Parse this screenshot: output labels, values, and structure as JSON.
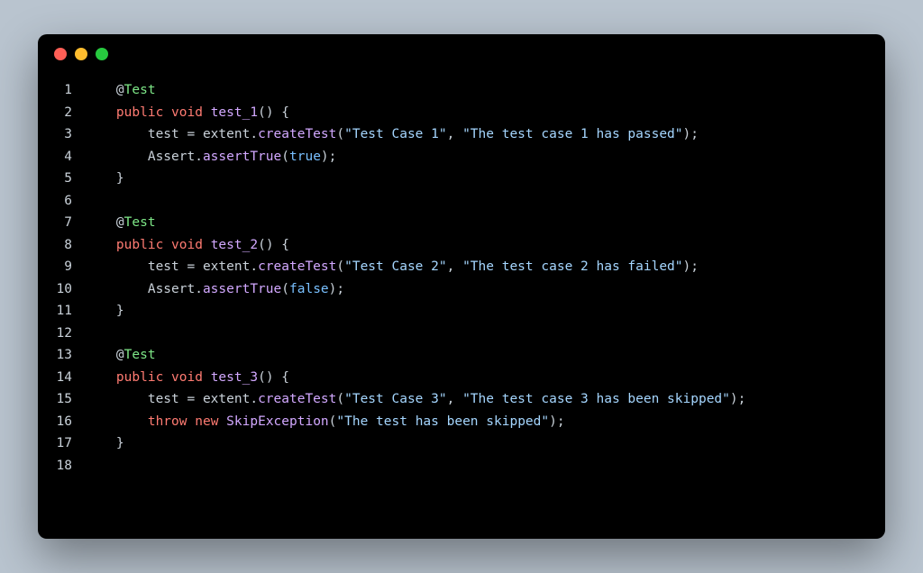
{
  "titlebar": {
    "buttons": [
      "close",
      "minimize",
      "zoom"
    ]
  },
  "code": {
    "lines": [
      {
        "num": "1",
        "tokens": [
          {
            "t": "    ",
            "c": "tok-ident"
          },
          {
            "t": "@",
            "c": "tok-at"
          },
          {
            "t": "Test",
            "c": "tok-annotation"
          }
        ]
      },
      {
        "num": "2",
        "tokens": [
          {
            "t": "    ",
            "c": "tok-ident"
          },
          {
            "t": "public",
            "c": "tok-keyword"
          },
          {
            "t": " ",
            "c": "tok-ident"
          },
          {
            "t": "void",
            "c": "tok-type"
          },
          {
            "t": " ",
            "c": "tok-ident"
          },
          {
            "t": "test_1",
            "c": "tok-method"
          },
          {
            "t": "() {",
            "c": "tok-punc"
          }
        ]
      },
      {
        "num": "3",
        "tokens": [
          {
            "t": "        test = extent.",
            "c": "tok-ident"
          },
          {
            "t": "createTest",
            "c": "tok-method"
          },
          {
            "t": "(",
            "c": "tok-punc"
          },
          {
            "t": "\"Test Case 1\"",
            "c": "tok-string"
          },
          {
            "t": ", ",
            "c": "tok-punc"
          },
          {
            "t": "\"The test case 1 has passed\"",
            "c": "tok-string"
          },
          {
            "t": ");",
            "c": "tok-punc"
          }
        ]
      },
      {
        "num": "4",
        "tokens": [
          {
            "t": "        Assert.",
            "c": "tok-ident"
          },
          {
            "t": "assertTrue",
            "c": "tok-method"
          },
          {
            "t": "(",
            "c": "tok-punc"
          },
          {
            "t": "true",
            "c": "tok-bool"
          },
          {
            "t": ");",
            "c": "tok-punc"
          }
        ]
      },
      {
        "num": "5",
        "tokens": [
          {
            "t": "    }",
            "c": "tok-punc"
          }
        ]
      },
      {
        "num": "6",
        "tokens": [
          {
            "t": "",
            "c": "tok-ident"
          }
        ]
      },
      {
        "num": "7",
        "tokens": [
          {
            "t": "    ",
            "c": "tok-ident"
          },
          {
            "t": "@",
            "c": "tok-at"
          },
          {
            "t": "Test",
            "c": "tok-annotation"
          }
        ]
      },
      {
        "num": "8",
        "tokens": [
          {
            "t": "    ",
            "c": "tok-ident"
          },
          {
            "t": "public",
            "c": "tok-keyword"
          },
          {
            "t": " ",
            "c": "tok-ident"
          },
          {
            "t": "void",
            "c": "tok-type"
          },
          {
            "t": " ",
            "c": "tok-ident"
          },
          {
            "t": "test_2",
            "c": "tok-method"
          },
          {
            "t": "() {",
            "c": "tok-punc"
          }
        ]
      },
      {
        "num": "9",
        "tokens": [
          {
            "t": "        test = extent.",
            "c": "tok-ident"
          },
          {
            "t": "createTest",
            "c": "tok-method"
          },
          {
            "t": "(",
            "c": "tok-punc"
          },
          {
            "t": "\"Test Case 2\"",
            "c": "tok-string"
          },
          {
            "t": ", ",
            "c": "tok-punc"
          },
          {
            "t": "\"The test case 2 has failed\"",
            "c": "tok-string"
          },
          {
            "t": ");",
            "c": "tok-punc"
          }
        ]
      },
      {
        "num": "10",
        "tokens": [
          {
            "t": "        Assert.",
            "c": "tok-ident"
          },
          {
            "t": "assertTrue",
            "c": "tok-method"
          },
          {
            "t": "(",
            "c": "tok-punc"
          },
          {
            "t": "false",
            "c": "tok-bool"
          },
          {
            "t": ");",
            "c": "tok-punc"
          }
        ]
      },
      {
        "num": "11",
        "tokens": [
          {
            "t": "    }",
            "c": "tok-punc"
          }
        ]
      },
      {
        "num": "12",
        "tokens": [
          {
            "t": "",
            "c": "tok-ident"
          }
        ]
      },
      {
        "num": "13",
        "tokens": [
          {
            "t": "    ",
            "c": "tok-ident"
          },
          {
            "t": "@",
            "c": "tok-at"
          },
          {
            "t": "Test",
            "c": "tok-annotation"
          }
        ]
      },
      {
        "num": "14",
        "tokens": [
          {
            "t": "    ",
            "c": "tok-ident"
          },
          {
            "t": "public",
            "c": "tok-keyword"
          },
          {
            "t": " ",
            "c": "tok-ident"
          },
          {
            "t": "void",
            "c": "tok-type"
          },
          {
            "t": " ",
            "c": "tok-ident"
          },
          {
            "t": "test_3",
            "c": "tok-method"
          },
          {
            "t": "() {",
            "c": "tok-punc"
          }
        ]
      },
      {
        "num": "15",
        "tokens": [
          {
            "t": "        test = extent.",
            "c": "tok-ident"
          },
          {
            "t": "createTest",
            "c": "tok-method"
          },
          {
            "t": "(",
            "c": "tok-punc"
          },
          {
            "t": "\"Test Case 3\"",
            "c": "tok-string"
          },
          {
            "t": ", ",
            "c": "tok-punc"
          },
          {
            "t": "\"The test case 3 has been skipped\"",
            "c": "tok-string"
          },
          {
            "t": ");",
            "c": "tok-punc"
          }
        ]
      },
      {
        "num": "16",
        "tokens": [
          {
            "t": "        ",
            "c": "tok-ident"
          },
          {
            "t": "throw",
            "c": "tok-keyword"
          },
          {
            "t": " ",
            "c": "tok-ident"
          },
          {
            "t": "new",
            "c": "tok-keyword"
          },
          {
            "t": " ",
            "c": "tok-ident"
          },
          {
            "t": "SkipException",
            "c": "tok-method"
          },
          {
            "t": "(",
            "c": "tok-punc"
          },
          {
            "t": "\"The test has been skipped\"",
            "c": "tok-string"
          },
          {
            "t": ");",
            "c": "tok-punc"
          }
        ]
      },
      {
        "num": "17",
        "tokens": [
          {
            "t": "    }",
            "c": "tok-punc"
          }
        ]
      },
      {
        "num": "18",
        "tokens": [
          {
            "t": "",
            "c": "tok-ident"
          }
        ]
      }
    ]
  }
}
